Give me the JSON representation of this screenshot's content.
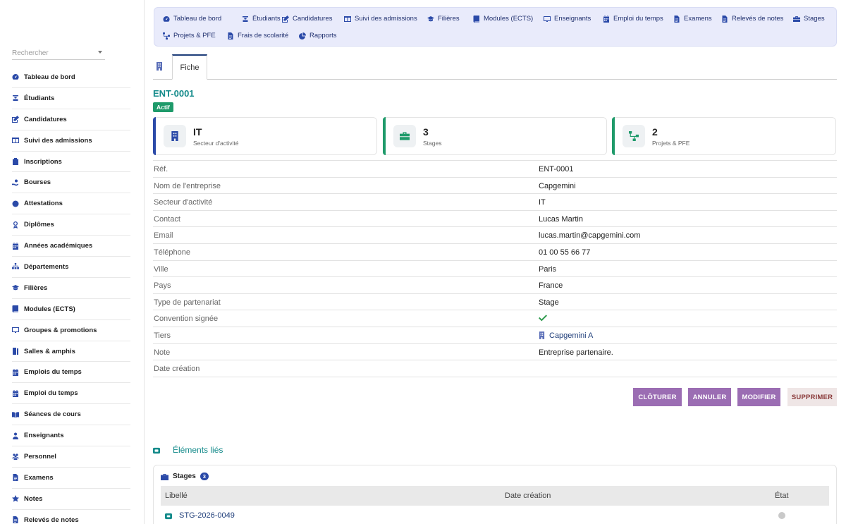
{
  "sidebar": {
    "search_placeholder": "Rechercher",
    "items": [
      {
        "label": "Tableau de bord",
        "icon": "gauge-icon"
      },
      {
        "label": "Étudiants",
        "icon": "graduate-icon"
      },
      {
        "label": "Candidatures",
        "icon": "edit-icon"
      },
      {
        "label": "Suivi des admissions",
        "icon": "columns-icon"
      },
      {
        "label": "Inscriptions",
        "icon": "clipboard-icon"
      },
      {
        "label": "Bourses",
        "icon": "hand-coin-icon"
      },
      {
        "label": "Attestations",
        "icon": "seal-icon"
      },
      {
        "label": "Diplômes",
        "icon": "award-icon"
      },
      {
        "label": "Années académiques",
        "icon": "calendar-icon"
      },
      {
        "label": "Départements",
        "icon": "sitemap-icon"
      },
      {
        "label": "Filières",
        "icon": "graduation-cap-icon"
      },
      {
        "label": "Modules (ECTS)",
        "icon": "book-icon"
      },
      {
        "label": "Groupes & promotions",
        "icon": "chalkboard-icon"
      },
      {
        "label": "Salles & amphis",
        "icon": "door-icon"
      },
      {
        "label": "Emplois du temps",
        "icon": "calendar-icon"
      },
      {
        "label": "Emploi du temps",
        "icon": "calendar-icon"
      },
      {
        "label": "Séances de cours",
        "icon": "open-book-icon"
      },
      {
        "label": "Enseignants",
        "icon": "teacher-icon"
      },
      {
        "label": "Personnel",
        "icon": "users-icon"
      },
      {
        "label": "Examens",
        "icon": "file-icon"
      },
      {
        "label": "Notes",
        "icon": "star-icon"
      },
      {
        "label": "Relevés de notes",
        "icon": "file-icon"
      }
    ]
  },
  "topnav": {
    "items": [
      {
        "label": "Tableau de bord",
        "icon": "gauge-icon"
      },
      {
        "label": "Étudiants",
        "icon": "graduate-icon"
      },
      {
        "label": "Candidatures",
        "icon": "edit-icon"
      },
      {
        "label": "Suivi des admissions",
        "icon": "columns-icon"
      },
      {
        "label": "Filières",
        "icon": "graduation-cap-icon"
      },
      {
        "label": "Modules (ECTS)",
        "icon": "book-icon"
      },
      {
        "label": "Enseignants",
        "icon": "chalkboard-icon"
      },
      {
        "label": "Emploi du temps",
        "icon": "calendar-icon"
      },
      {
        "label": "Examens",
        "icon": "file-icon"
      },
      {
        "label": "Relevés de notes",
        "icon": "file-icon"
      },
      {
        "label": "Stages",
        "icon": "briefcase-icon"
      },
      {
        "label": "Projets & PFE",
        "icon": "project-icon"
      },
      {
        "label": "Frais de scolarité",
        "icon": "file-icon"
      },
      {
        "label": "Rapports",
        "icon": "pie-icon"
      }
    ]
  },
  "tabs": {
    "fiche_label": "Fiche"
  },
  "record": {
    "id": "ENT-0001",
    "status": "Actif"
  },
  "cards": [
    {
      "value": "IT",
      "label": "Secteur d'activité",
      "accent": "#2b4aa8",
      "icon": "building-icon"
    },
    {
      "value": "3",
      "label": "Stages",
      "accent": "#1e9a6a",
      "icon": "briefcase-icon"
    },
    {
      "value": "2",
      "label": "Projets & PFE",
      "accent": "#1e9a6a",
      "icon": "project-icon"
    }
  ],
  "details": [
    {
      "key": "Réf.",
      "value": "ENT-0001"
    },
    {
      "key": "Nom de l'entreprise",
      "value": "Capgemini"
    },
    {
      "key": "Secteur d'activité",
      "value": "IT"
    },
    {
      "key": "Contact",
      "value": "Lucas Martin"
    },
    {
      "key": "Email",
      "value": "lucas.martin@capgemini.com"
    },
    {
      "key": "Téléphone",
      "value": "01 00 55 66 77"
    },
    {
      "key": "Ville",
      "value": "Paris"
    },
    {
      "key": "Pays",
      "value": "France"
    },
    {
      "key": "Type de partenariat",
      "value": "Stage"
    },
    {
      "key": "Convention signée",
      "value": ""
    },
    {
      "key": "Tiers",
      "value": "Capgemini A"
    },
    {
      "key": "Note",
      "value": "Entreprise partenaire."
    },
    {
      "key": "Date création",
      "value": ""
    }
  ],
  "actions": {
    "cloturer": "CLÔTURER",
    "annuler": "ANNULER",
    "modifier": "MODIFIER",
    "supprimer": "SUPPRIMER"
  },
  "linked": {
    "title": "Éléments liés",
    "panel_title": "Stages",
    "count": "3",
    "columns": [
      "Libellé",
      "Date création",
      "État"
    ],
    "rows": [
      {
        "ref": "STG-2026-0049"
      }
    ]
  }
}
